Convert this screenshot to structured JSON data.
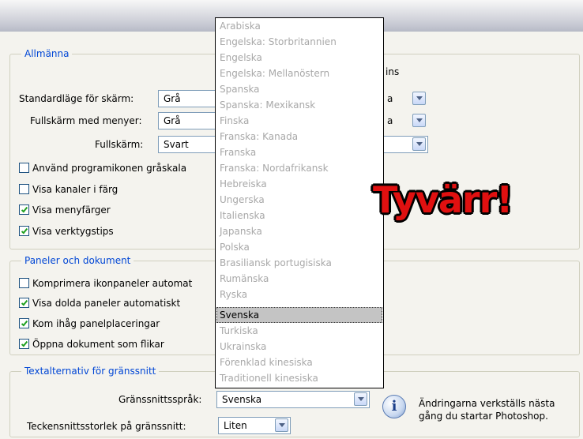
{
  "general": {
    "legend": "Allmänna",
    "screen_mode_label": "Standardläge för skärm:",
    "screen_mode_value": "Grå",
    "fullscreen_menus_label": "Fullskärm med menyer:",
    "fullscreen_menus_value": "Grå",
    "fullscreen_label": "Fullskärm:",
    "fullscreen_value": "Svart",
    "partial_right_header": "ins",
    "partial_right_1": "a",
    "partial_right_2": "a",
    "checkboxes": [
      {
        "label": "Använd programikonen gråskala",
        "checked": false
      },
      {
        "label": "Visa kanaler i färg",
        "checked": false
      },
      {
        "label": "Visa menyfärger",
        "checked": true
      },
      {
        "label": "Visa verktygstips",
        "checked": true
      }
    ]
  },
  "panels": {
    "legend": "Paneler och dokument",
    "checkboxes": [
      {
        "label": "Komprimera ikonpaneler automat",
        "checked": false
      },
      {
        "label": "Visa dolda paneler automatiskt",
        "checked": true
      },
      {
        "label": "Kom ihåg panelplaceringar",
        "checked": true
      },
      {
        "label": "Öppna dokument som flikar",
        "checked": true
      }
    ]
  },
  "text_options": {
    "legend": "Textalternativ för gränssnitt",
    "language_label": "Gränssnittsspråk:",
    "language_value": "Svenska",
    "fontsize_label": "Teckensnittsstorlek på gränssnitt:",
    "fontsize_value": "Liten",
    "info_line1": "Ändringarna verkställs nästa",
    "info_line2": "gång du startar Photoshop."
  },
  "language_dropdown": {
    "options": [
      "Arabiska",
      "Engelska: Storbritannien",
      "Engelska",
      "Engelska: Mellanöstern",
      "Spanska",
      "Spanska: Mexikansk",
      "Finska",
      "Franska: Kanada",
      "Franska",
      "Franska: Nordafrikansk",
      "Hebreiska",
      "Ungerska",
      "Italienska",
      "Japanska",
      "Polska",
      "Brasiliansk portugisiska",
      "Rumänska",
      "Ryska",
      "Svenska",
      "Turkiska",
      "Ukrainska",
      "Förenklad kinesiska",
      "Traditionell kinesiska"
    ],
    "selected": "Svenska"
  },
  "overlay_text": "Tyvärr!",
  "colors": {
    "legend_blue": "#0046d5",
    "overlay_red": "#e01010",
    "disabled_gray": "#a8a8a8",
    "selected_bg": "#c4c4c4",
    "checkmark_green": "#21a121"
  }
}
